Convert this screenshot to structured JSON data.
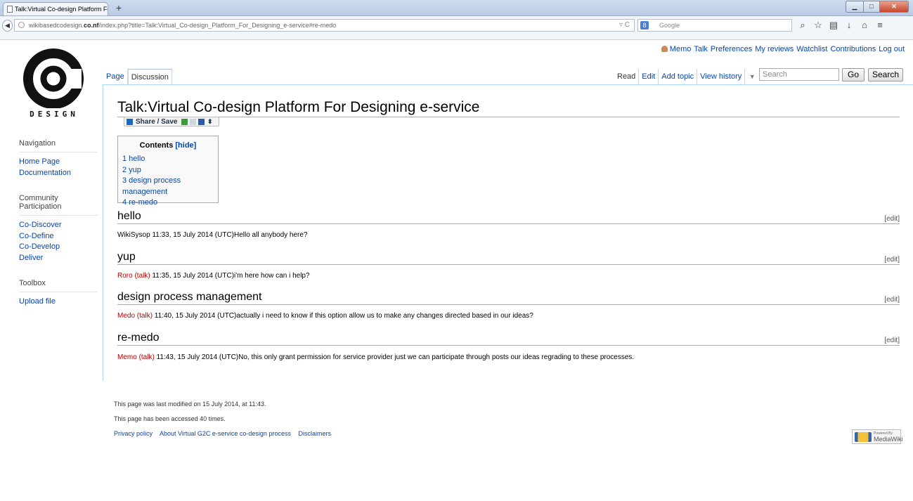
{
  "browser": {
    "tab_title": "Talk:Virtual Co-design Platform Fo...",
    "url_host": "wikibasedcodesign.co.nf",
    "url_pre": "wikibasedcodesign.",
    "url_bold": "co.nf",
    "url_path": "/index.php?title=Talk:Virtual_Co-design_Platform_For_Designing_e-service#re-medo",
    "search_engine": "Google",
    "search_placeholder": "Google"
  },
  "logo": {
    "letter": "C",
    "word": "DESIGN"
  },
  "personal": {
    "user": "Memo",
    "links": [
      "Talk",
      "Preferences",
      "My reviews",
      "Watchlist",
      "Contributions",
      "Log out"
    ]
  },
  "tabs": {
    "left": [
      "Page",
      "Discussion"
    ],
    "right": [
      "Read",
      "Edit",
      "Add topic",
      "View history"
    ]
  },
  "search": {
    "placeholder": "Search",
    "go": "Go",
    "search": "Search"
  },
  "page": {
    "title": "Talk:Virtual Co-design Platform For Designing e-service",
    "share_label": "Share / Save"
  },
  "toc": {
    "title": "Contents",
    "hide": "[hide]",
    "items": [
      "1 hello",
      "2 yup",
      "3 design process management",
      "4 re-medo"
    ]
  },
  "sections": [
    {
      "heading": "hello",
      "edit": "[edit]",
      "author": "",
      "talk": "",
      "text": "WikiSysop 11:33, 15 July 2014 (UTC)Hello all anybody here?"
    },
    {
      "heading": "yup",
      "edit": "[edit]",
      "author": "Roro",
      "talk": "(talk)",
      "text": " 11:35, 15 July 2014 (UTC)i'm here how can i help?"
    },
    {
      "heading": "design process management",
      "edit": "[edit]",
      "author": "Medo",
      "talk": "(talk)",
      "text": " 11:40, 15 July 2014 (UTC)actually i need to know if this option allow us to make any changes directed based in our ideas?"
    },
    {
      "heading": "re-medo",
      "edit": "[edit]",
      "author": "Memo",
      "talk": "(talk)",
      "text": " 11:43, 15 July 2014 (UTC)No, this only grant permission for service provider just we can participate through posts our ideas regrading to these processes."
    }
  ],
  "sidebar": {
    "navigation": {
      "heading": "Navigation",
      "items": [
        "Home Page",
        "Documentation"
      ]
    },
    "community": {
      "heading": "Community Participation",
      "items": [
        "Co-Discover",
        "Co-Define",
        "Co-Develop",
        "Deliver"
      ]
    },
    "toolbox": {
      "heading": "Toolbox",
      "items": [
        "Upload file"
      ]
    }
  },
  "footer": {
    "modified": "This page was last modified on 15 July 2014, at 11:43.",
    "accessed": "This page has been accessed 40 times.",
    "links": [
      "Privacy policy",
      "About Virtual G2C e-service co-design process",
      "Disclaimers"
    ],
    "badge_small": "Powered By",
    "badge_big": "MediaWiki"
  },
  "colors": {
    "link": "#0645ad",
    "redlink": "#ba0000",
    "content_border": "#a7d7f9"
  }
}
